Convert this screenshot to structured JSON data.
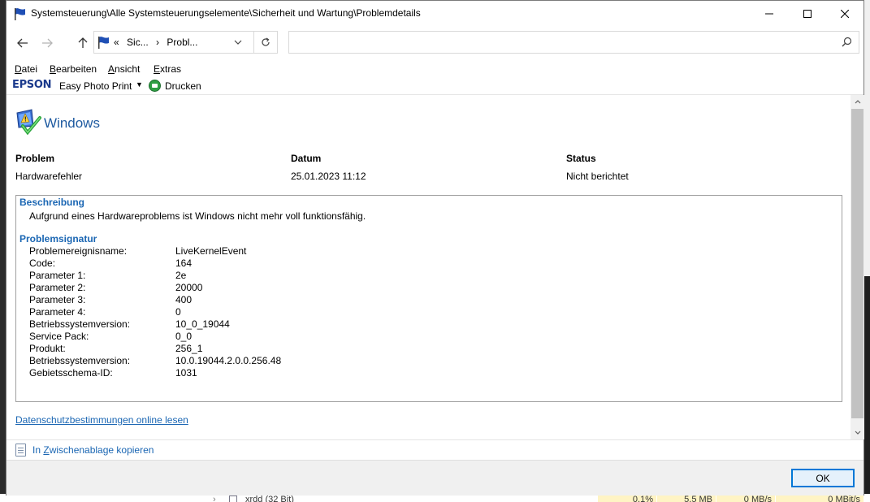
{
  "window": {
    "title": "Systemsteuerung\\Alle Systemsteuerungselemente\\Sicherheit und Wartung\\Problemdetails"
  },
  "nav": {
    "breadcrumb_overflow": "«",
    "crumbs": [
      "Sic...",
      "Probl..."
    ],
    "search_placeholder": ""
  },
  "menu": {
    "items": [
      {
        "label_first": "D",
        "label_rest": "atei"
      },
      {
        "label_first": "B",
        "label_rest": "earbeiten"
      },
      {
        "label_first": "A",
        "label_rest": "nsicht"
      },
      {
        "label_first": "E",
        "label_rest": "xtras"
      }
    ]
  },
  "epson": {
    "logo": "EPSON",
    "app_label": "Easy Photo Print",
    "dropdown_glyph": "▼",
    "print_label": "Drucken"
  },
  "header": {
    "title": "Windows"
  },
  "summary": {
    "problem_label": "Problem",
    "problem_value": "Hardwarefehler",
    "date_label": "Datum",
    "date_value": "25.01.2023 11:12",
    "status_label": "Status",
    "status_value": "Nicht berichtet"
  },
  "description": {
    "title": "Beschreibung",
    "text": "Aufgrund eines Hardwareproblems ist Windows nicht mehr voll funktionsfähig."
  },
  "signature": {
    "title": "Problemsignatur",
    "rows": [
      {
        "key": "Problemereignisname:",
        "value": "LiveKernelEvent"
      },
      {
        "key": "Code:",
        "value": "164"
      },
      {
        "key": "Parameter 1:",
        "value": "2e"
      },
      {
        "key": "Parameter 2:",
        "value": "20000"
      },
      {
        "key": "Parameter 3:",
        "value": "400"
      },
      {
        "key": "Parameter 4:",
        "value": "0"
      },
      {
        "key": "Betriebssystemversion:",
        "value": "10_0_19044"
      },
      {
        "key": "Service Pack:",
        "value": "0_0"
      },
      {
        "key": "Produkt:",
        "value": "256_1"
      },
      {
        "key": "Betriebssystemversion:",
        "value": "10.0.19044.2.0.0.256.48"
      },
      {
        "key": "Gebietsschema-ID:",
        "value": "1031"
      }
    ]
  },
  "links": {
    "privacy": "Datenschutzbestimmungen online lesen",
    "copy_prefix": "In ",
    "copy_underlined": "Z",
    "copy_rest": "wischenablage kopieren"
  },
  "footer": {
    "ok_label": "OK"
  },
  "background": {
    "process_name": "xrdd (32 Bit)",
    "cpu": "0,1%",
    "memory": "5,5 MB",
    "disk": "0 MB/s",
    "network": "0 MBit/s"
  }
}
